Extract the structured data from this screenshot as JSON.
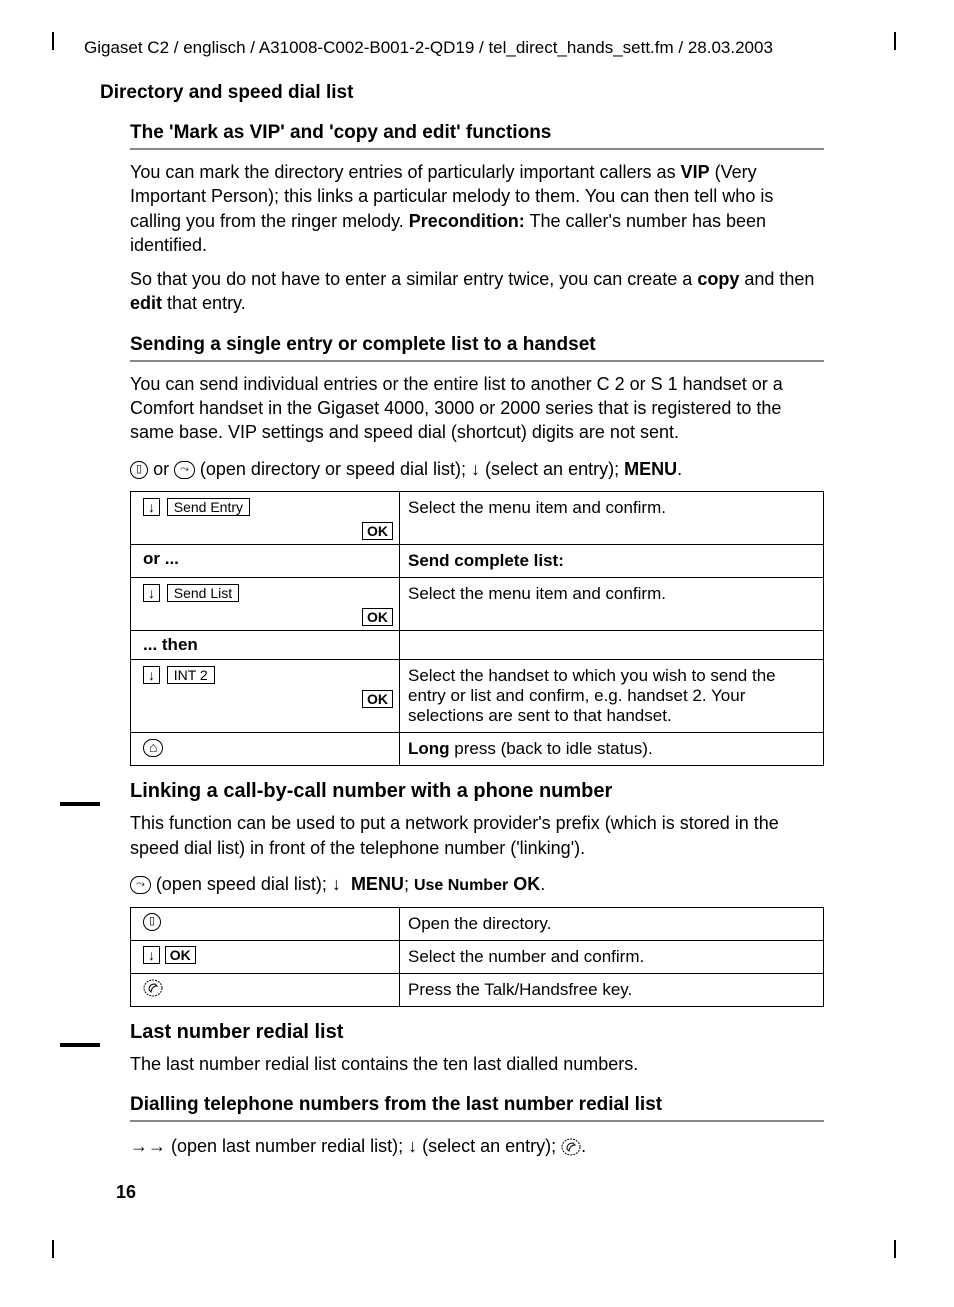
{
  "header": "Gigaset C2 / englisch / A31008-C002-B001-2-QD19 / tel_direct_hands_sett.fm / 28.03.2003",
  "section_title": "Directory and speed dial list",
  "sub1": {
    "title": "The 'Mark as VIP' and 'copy and edit' functions",
    "p1a": "You can mark the directory entries of particularly important callers as ",
    "p1b": "VIP",
    "p1c": " (Very Important Person); this links a particular melody to them. You can then tell who is calling you from the ringer melody. ",
    "p1d": "Precondition:",
    "p1e": " The caller's number has been identified.",
    "p2a": "So that you do not have to enter a similar entry twice, you can create a ",
    "p2b": "copy",
    "p2c": " and then ",
    "p2d": "edit",
    "p2e": " that entry."
  },
  "sub2": {
    "title": "Sending a single entry or complete list to a handset",
    "p1": "You can send individual entries or the entire list to another C 2 or S 1 handset or a Comfort handset in the Gigaset 4000, 3000 or 2000 series that is registered to the same base. VIP settings and speed dial (shortcut) digits are not sent.",
    "seq_a": " or ",
    "seq_b": " (open directory or speed dial list);   ",
    "seq_c": "   (select an entry); ",
    "seq_menu": "MENU",
    "seq_d": "."
  },
  "table1": {
    "r1_label": "Send Entry",
    "r1_ok": "OK",
    "r1_right": "Select the menu item and confirm.",
    "r2_left": "or ...",
    "r2_right": "Send complete list:",
    "r3_label": "Send List",
    "r3_ok": "OK",
    "r3_right": "Select the menu item and confirm.",
    "r4_left": "... then",
    "r5_label": "INT 2",
    "r5_ok": "OK",
    "r5_right": "Select the handset to which you wish to send the entry or list and confirm, e.g. handset 2. Your selections are sent to that handset.",
    "r6_right_a": "Long",
    "r6_right_b": " press (back to idle status)."
  },
  "sub3": {
    "title": "Linking a call-by-call number with a phone number",
    "p1": "This function can be used to put a network provider's prefix (which is stored in the speed dial list) in front of the telephone number ('linking').",
    "seq_a": " (open speed dial list);   ",
    "seq_menu": "MENU",
    "seq_b": "; ",
    "seq_use": "Use Number",
    "seq_ok": "OK",
    "seq_c": "."
  },
  "table2": {
    "r1_right": "Open the directory.",
    "r2_ok": "OK",
    "r2_right": "Select the number and confirm.",
    "r3_right": "Press the Talk/Handsfree key."
  },
  "sub4": {
    "title": "Last number redial list",
    "p1": "The last number redial list contains the ten last dialled numbers."
  },
  "sub5": {
    "title": "Dialling telephone numbers from the last number redial list",
    "seq_a": "→→",
    "seq_b": " (open last number redial list);   ",
    "seq_c": "   (select an entry); ",
    "seq_d": "."
  },
  "page_num": "16"
}
